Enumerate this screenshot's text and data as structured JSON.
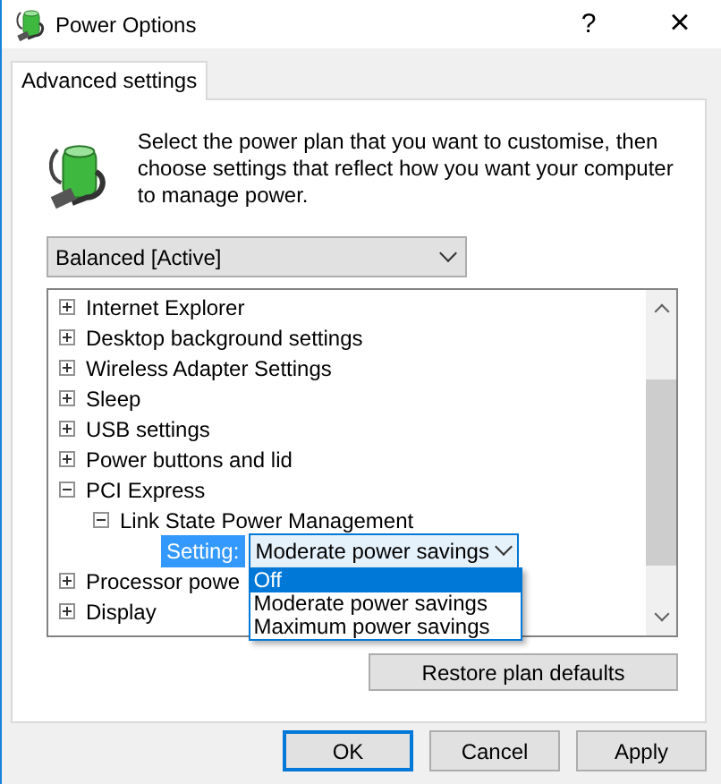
{
  "window": {
    "title": "Power Options",
    "help": "?",
    "close": "×"
  },
  "tabs": [
    {
      "label": "Advanced settings",
      "selected": true
    }
  ],
  "description": "Select the power plan that you want to customise, then choose settings that reflect how you want your computer to manage power.",
  "plan_dropdown": {
    "value": "Balanced [Active]"
  },
  "tree": {
    "items": [
      {
        "kind": "group",
        "label": "Internet Explorer",
        "expanded": false
      },
      {
        "kind": "group",
        "label": "Desktop background settings",
        "expanded": false
      },
      {
        "kind": "group",
        "label": "Wireless Adapter Settings",
        "expanded": false
      },
      {
        "kind": "group",
        "label": "Sleep",
        "expanded": false
      },
      {
        "kind": "group",
        "label": "USB settings",
        "expanded": false
      },
      {
        "kind": "group",
        "label": "Power buttons and lid",
        "expanded": false
      },
      {
        "kind": "group",
        "label": "PCI Express",
        "expanded": true,
        "children": [
          {
            "kind": "group",
            "label": "Link State Power Management",
            "expanded": true,
            "children": [
              {
                "kind": "setting",
                "label": "Setting:",
                "value": "Moderate power savings",
                "open": true,
                "options": [
                  {
                    "label": "Off",
                    "highlighted": true
                  },
                  {
                    "label": "Moderate power savings",
                    "highlighted": false
                  },
                  {
                    "label": "Maximum power savings",
                    "highlighted": false
                  }
                ]
              }
            ]
          }
        ]
      },
      {
        "kind": "group",
        "label": "Processor powe",
        "expanded": false
      },
      {
        "kind": "group",
        "label": "Display",
        "expanded": false
      }
    ]
  },
  "restore_button": "Restore plan defaults",
  "buttons": [
    {
      "label": "OK",
      "focused": true
    },
    {
      "label": "Cancel",
      "focused": false
    },
    {
      "label": "Apply",
      "focused": false
    }
  ]
}
